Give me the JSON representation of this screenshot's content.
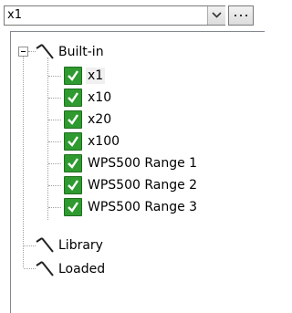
{
  "combo": {
    "value": "x1",
    "dropdown_icon": "chevron-down-icon",
    "more_icon": "ellipsis-icon"
  },
  "tree": {
    "root": {
      "label": "Built-in",
      "icon": "wand-icon",
      "expanded": true,
      "children": [
        {
          "label": "x1",
          "checked": true,
          "selected": true
        },
        {
          "label": "x10",
          "checked": true
        },
        {
          "label": "x20",
          "checked": true
        },
        {
          "label": "x100",
          "checked": true
        },
        {
          "label": "WPS500 Range 1",
          "checked": true
        },
        {
          "label": "WPS500 Range 2",
          "checked": true
        },
        {
          "label": "WPS500 Range 3",
          "checked": true
        }
      ]
    },
    "siblings": [
      {
        "label": "Library",
        "icon": "wand-icon"
      },
      {
        "label": "Loaded",
        "icon": "wand-icon"
      }
    ]
  },
  "colors": {
    "check_green": "#2f9a2f",
    "border": "#828790"
  }
}
